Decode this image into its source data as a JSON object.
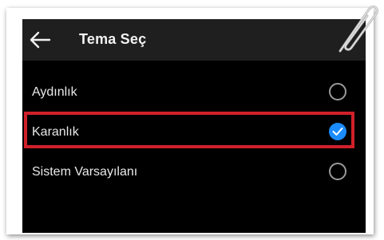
{
  "header": {
    "title": "Tema Seç"
  },
  "icons": {
    "back": "back-arrow-icon",
    "check": "checkmark-icon",
    "clip": "paperclip-icon"
  },
  "options": [
    {
      "label": "Aydınlık",
      "selected": false
    },
    {
      "label": "Karanlık",
      "selected": true
    },
    {
      "label": "Sistem Varsayılanı",
      "selected": false
    }
  ],
  "colors": {
    "accent": "#1a8cff",
    "highlight": "#d0202a",
    "background": "#000000",
    "topbar": "#1f1f1f"
  }
}
